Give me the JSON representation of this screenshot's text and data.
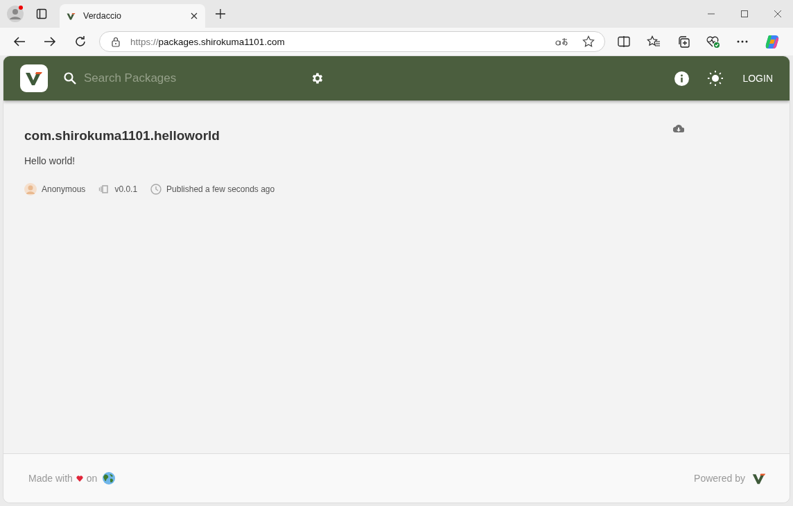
{
  "browser": {
    "tabs": [
      {
        "title": "Verdaccio",
        "selected": true
      }
    ],
    "address": {
      "scheme": "https://",
      "host": "packages.shirokuma1101.com"
    }
  },
  "header": {
    "search": {
      "placeholder": "Search Packages"
    },
    "login": "LOGIN"
  },
  "package": {
    "name": "com.shirokuma1101.helloworld",
    "description": "Hello world!",
    "author": "Anonymous",
    "version": "v0.0.1",
    "published": "Published a few seconds ago"
  },
  "footer": {
    "made_with": "Made with",
    "on": "on",
    "powered_by": "Powered by"
  }
}
